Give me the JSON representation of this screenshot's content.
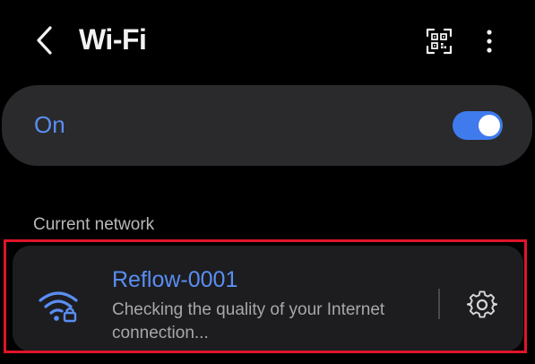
{
  "header": {
    "title": "Wi-Fi",
    "back_icon": "chevron-left-icon",
    "qr_icon": "qr-code-scan-icon",
    "more_icon": "more-vertical-icon"
  },
  "wifi_toggle": {
    "label": "On",
    "state": true,
    "accent_color": "#3f7bec"
  },
  "current_network": {
    "section_title": "Current network",
    "name": "Reflow-0001",
    "status": "Checking the quality of your Internet connection...",
    "icon": "wifi-lock-icon",
    "settings_icon": "gear-icon"
  },
  "colors": {
    "background": "#000000",
    "card": "#2a2a2c",
    "accent_text": "#5a8ef2",
    "highlight_border": "#e0142a"
  }
}
